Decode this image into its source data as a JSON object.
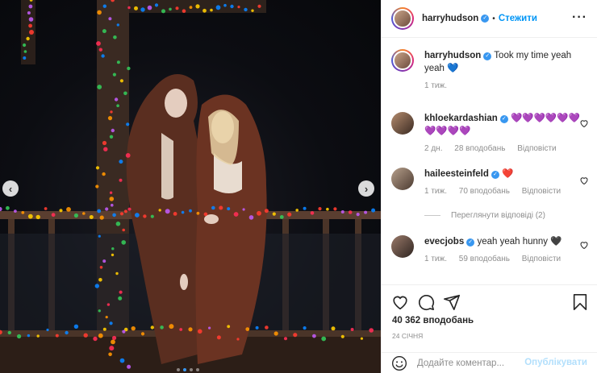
{
  "header": {
    "username": "harryhudson",
    "separator": "•",
    "follow_label": "Стежити",
    "more_icon": "more-horizontal-icon"
  },
  "caption": {
    "username": "harryhudson",
    "text": "Took my time yeah yeah",
    "emoji": "💙",
    "time": "1 тиж."
  },
  "comments": [
    {
      "username": "khloekardashian",
      "verified": true,
      "text": "💜💜💜💜💜💜💜💜💜💜",
      "time": "2 дн.",
      "likes": "28 вподобань",
      "reply": "Відповісти"
    },
    {
      "username": "haileesteinfeld",
      "verified": true,
      "text": "❤️",
      "time": "1 тиж.",
      "likes": "70 вподобань",
      "reply": "Відповісти",
      "view_replies": "Переглянути відповіді (2)"
    },
    {
      "username": "evecjobs",
      "verified": true,
      "text": "yeah yeah hunny 🖤",
      "time": "1 тиж.",
      "likes": "59 вподобань",
      "reply": "Відповісти"
    }
  ],
  "actions": {
    "icons": [
      "heart-icon",
      "comment-icon",
      "share-icon",
      "bookmark-icon"
    ],
    "likes_count": "40 362 вподобань",
    "date": "24 СІЧНЯ"
  },
  "add_comment": {
    "placeholder": "Додайте коментар...",
    "publish_label": "Опублікувати",
    "emoji_icon": "smiley-icon"
  },
  "carousel": {
    "slides": 4,
    "active_index": 1
  },
  "colors": {
    "accent": "#0095f6",
    "verified": "#3897f0",
    "muted": "#8e8e8e",
    "publish_disabled": "#b2dffc"
  }
}
